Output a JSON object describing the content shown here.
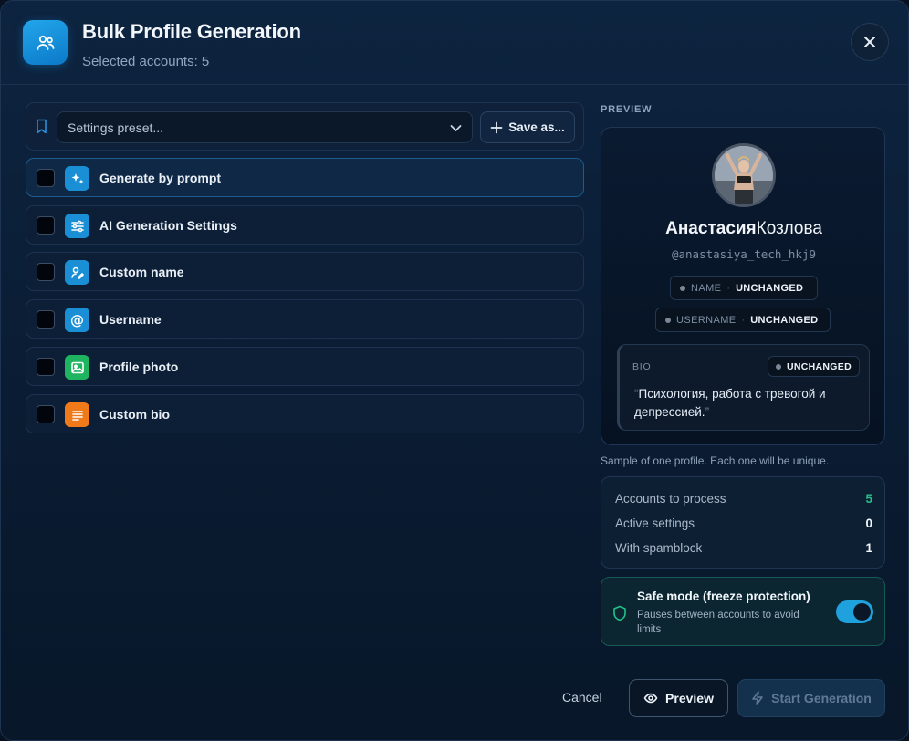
{
  "header": {
    "title": "Bulk Profile Generation",
    "subtitle": "Selected accounts: 5"
  },
  "preset": {
    "placeholder": "Settings preset...",
    "save_label": "Save as..."
  },
  "options": [
    {
      "label": "Generate by prompt",
      "icon": "sparkles-icon",
      "color": "#1a8fd6",
      "checked": false
    },
    {
      "label": "AI Generation Settings",
      "icon": "sliders-icon",
      "color": "#1a8fd6",
      "checked": false
    },
    {
      "label": "Custom name",
      "icon": "signature-icon",
      "color": "#1a8fd6",
      "checked": false
    },
    {
      "label": "Username",
      "icon": "at-sign-icon",
      "color": "#1a8fd6",
      "checked": false
    },
    {
      "label": "Profile photo",
      "icon": "image-icon",
      "color": "#1fb45f",
      "checked": false
    },
    {
      "label": "Custom bio",
      "icon": "text-lines-icon",
      "color": "#f07a1a",
      "checked": false
    }
  ],
  "preview": {
    "section_label": "PREVIEW",
    "first_name": "Анастасия",
    "last_name": "Козлова",
    "username": "@anastasiya_tech_hkj9",
    "name_chip": {
      "key": "NAME",
      "value": "UNCHANGED"
    },
    "username_chip": {
      "key": "USERNAME",
      "value": "UNCHANGED"
    },
    "bio": {
      "key": "BIO",
      "status": "UNCHANGED",
      "open_quote": "“",
      "text": "Психология, работа с тревогой и депрессией.",
      "close_quote": "”"
    },
    "note": "Sample of one profile. Each one will be unique."
  },
  "stats": [
    {
      "label": "Accounts to process",
      "value": "5",
      "accent": "#22c08a"
    },
    {
      "label": "Active settings",
      "value": "0",
      "accent": ""
    },
    {
      "label": "With spamblock",
      "value": "1",
      "accent": ""
    }
  ],
  "safe_mode": {
    "title": "Safe mode (freeze protection)",
    "description": "Pauses between accounts to avoid limits",
    "enabled": true
  },
  "footer": {
    "cancel_label": "Cancel",
    "preview_label": "Preview",
    "start_label": "Start Generation"
  },
  "colors": {
    "accent": "#1ea1dc",
    "success": "#22c08a",
    "background": "#0a1c33"
  }
}
